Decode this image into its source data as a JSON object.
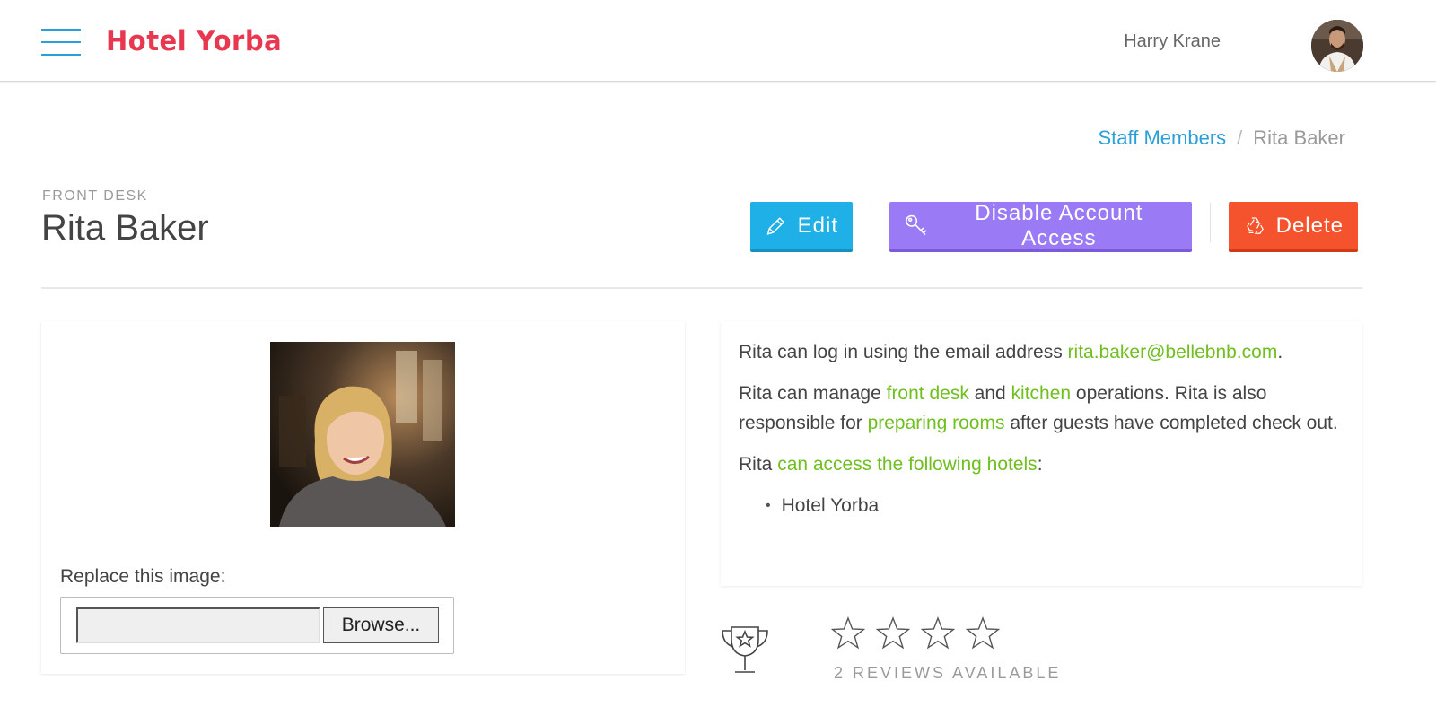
{
  "header": {
    "brand": "Hotel Yorba",
    "user_name": "Harry Krane"
  },
  "breadcrumb": {
    "parent": "Staff Members",
    "separator": "/",
    "current": "Rita Baker"
  },
  "profile": {
    "department": "FRONT DESK",
    "name": "Rita Baker"
  },
  "actions": {
    "edit": "Edit",
    "disable": "Disable Account Access",
    "delete": "Delete"
  },
  "photo_card": {
    "replace_label": "Replace this image:",
    "browse_label": "Browse..."
  },
  "details": {
    "email_prefix": "Rita can log in using the email address ",
    "email": "rita.baker@bellebnb.com",
    "email_suffix": ".",
    "manage_prefix": "Rita can manage ",
    "manage_link1": "front desk",
    "manage_and": " and ",
    "manage_link2": "kitchen",
    "manage_mid": " operations. Rita is also responsible for ",
    "manage_link3": "preparing rooms",
    "manage_suffix": " after guests have completed check out.",
    "access_prefix": "Rita ",
    "access_link": "can access the following hotels",
    "access_suffix": ":",
    "hotels": [
      "Hotel Yorba"
    ]
  },
  "reviews": {
    "rating": 0,
    "max_rating": 4,
    "count_text": "2 REVIEWS AVAILABLE"
  },
  "colors": {
    "brand": "#e8384f",
    "link_blue": "#2a9fd8",
    "accent_green": "#6fbf1f",
    "edit_button": "#1fb0e8",
    "disable_button": "#9b7bf5",
    "delete_button": "#f5532d"
  },
  "icons": {
    "menu": "hamburger-icon",
    "edit": "pencil-icon",
    "disable": "key-icon",
    "delete": "recycle-icon",
    "reviews": "trophy-icon",
    "rating": "star-icon"
  }
}
